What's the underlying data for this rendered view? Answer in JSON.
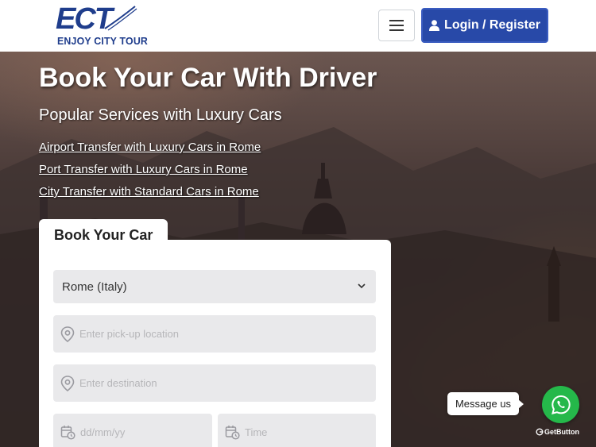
{
  "header": {
    "logo_mark": "ECT",
    "logo_name": "ENJOY CITY TOUR",
    "menu_icon": "hamburger-icon",
    "login_label": "Login / Register",
    "user_icon": "user-icon"
  },
  "hero": {
    "title": "Book Your Car With Driver",
    "subtitle": "Popular Services with Luxury Cars",
    "links": [
      "Airport Transfer with Luxury Cars in Rome",
      "Port Transfer with Luxury Cars in Rome",
      "City Transfer with Standard Cars in Rome"
    ]
  },
  "booking": {
    "tab_label": "Book Your Car",
    "city_selected": "Rome (Italy)",
    "pickup_placeholder": "Enter pick-up location",
    "destination_placeholder": "Enter destination",
    "date_placeholder": "dd/mm/yy",
    "time_placeholder": "Time"
  },
  "whatsapp": {
    "message_label": "Message us",
    "brand": "GetButton"
  },
  "colors": {
    "brand_blue": "#2849a8",
    "logo_blue": "#1f3d8c",
    "whatsapp_green": "#25b84a"
  }
}
